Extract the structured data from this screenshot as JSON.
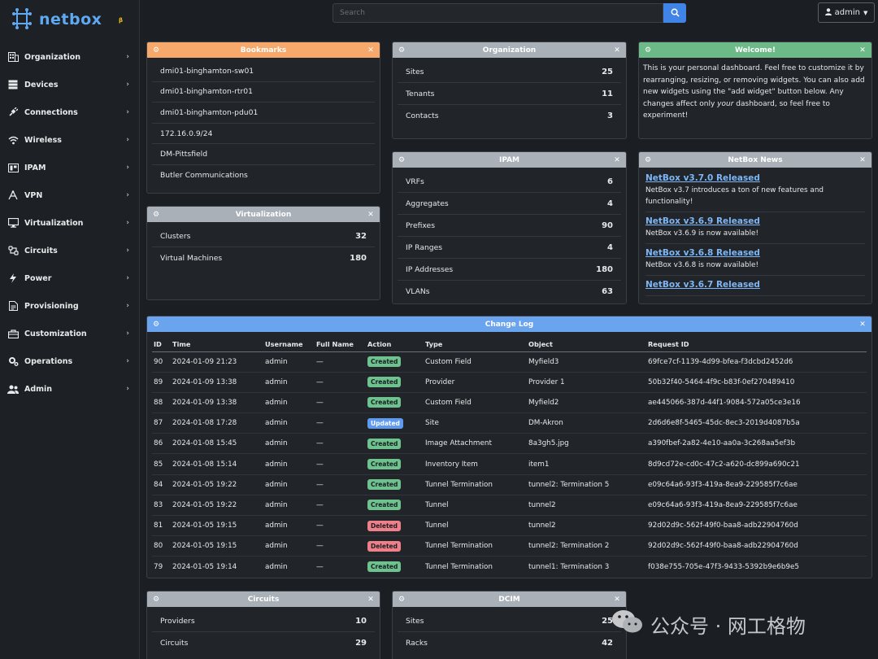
{
  "brand": {
    "name": "netbox",
    "tag": "β"
  },
  "sidebar": {
    "items": [
      {
        "label": "Organization",
        "icon": "building-icon"
      },
      {
        "label": "Devices",
        "icon": "server-icon"
      },
      {
        "label": "Connections",
        "icon": "plug-icon"
      },
      {
        "label": "Wireless",
        "icon": "wifi-icon"
      },
      {
        "label": "IPAM",
        "icon": "ip-icon"
      },
      {
        "label": "VPN",
        "icon": "tunnel-icon"
      },
      {
        "label": "Virtualization",
        "icon": "monitor-icon"
      },
      {
        "label": "Circuits",
        "icon": "circuit-icon"
      },
      {
        "label": "Power",
        "icon": "bolt-icon"
      },
      {
        "label": "Provisioning",
        "icon": "file-icon"
      },
      {
        "label": "Customization",
        "icon": "toolbox-icon"
      },
      {
        "label": "Operations",
        "icon": "cogs-icon"
      },
      {
        "label": "Admin",
        "icon": "users-icon"
      }
    ]
  },
  "search": {
    "placeholder": "Search"
  },
  "user": {
    "label": "admin"
  },
  "bookmarks": {
    "title": "Bookmarks",
    "items": [
      "dmi01-binghamton-sw01",
      "dmi01-binghamton-rtr01",
      "dmi01-binghamton-pdu01",
      "172.16.0.9/24",
      "DM-Pittsfield",
      "Butler Communications"
    ]
  },
  "organization": {
    "title": "Organization",
    "rows": [
      {
        "label": "Sites",
        "value": "25"
      },
      {
        "label": "Tenants",
        "value": "11"
      },
      {
        "label": "Contacts",
        "value": "3"
      }
    ]
  },
  "welcome": {
    "title": "Welcome!",
    "text_a": "This is your personal dashboard. Feel free to customize it by rearranging, resizing, or removing widgets. You can also add new widgets using the \"add widget\" button below. Any changes affect only ",
    "text_em": "your",
    "text_b": " dashboard, so feel free to experiment!"
  },
  "virtualization": {
    "title": "Virtualization",
    "rows": [
      {
        "label": "Clusters",
        "value": "32"
      },
      {
        "label": "Virtual Machines",
        "value": "180"
      }
    ]
  },
  "ipam": {
    "title": "IPAM",
    "rows": [
      {
        "label": "VRFs",
        "value": "6"
      },
      {
        "label": "Aggregates",
        "value": "4"
      },
      {
        "label": "Prefixes",
        "value": "90"
      },
      {
        "label": "IP Ranges",
        "value": "4"
      },
      {
        "label": "IP Addresses",
        "value": "180"
      },
      {
        "label": "VLANs",
        "value": "63"
      }
    ]
  },
  "news": {
    "title": "NetBox News",
    "items": [
      {
        "title": "NetBox v3.7.0 Released",
        "body": "NetBox v3.7 introduces a ton of new features and functionality!"
      },
      {
        "title": "NetBox v3.6.9 Released",
        "body": "NetBox v3.6.9 is now available!"
      },
      {
        "title": "NetBox v3.6.8 Released",
        "body": "NetBox v3.6.8 is now available!"
      },
      {
        "title": "NetBox v3.6.7 Released",
        "body": ""
      }
    ]
  },
  "changelog": {
    "title": "Change Log",
    "columns": [
      "ID",
      "Time",
      "Username",
      "Full Name",
      "Action",
      "Type",
      "Object",
      "Request ID"
    ],
    "rows": [
      {
        "id": "90",
        "time": "2024-01-09 21:23",
        "user": "admin",
        "full": "—",
        "action": "Created",
        "kind": "created",
        "type": "Custom Field",
        "object": "Myfield3",
        "obj_link": true,
        "req": "69fce7cf-1139-4d99-bfea-f3dcbd2452d6"
      },
      {
        "id": "89",
        "time": "2024-01-09 13:38",
        "user": "admin",
        "full": "—",
        "action": "Created",
        "kind": "created",
        "type": "Provider",
        "object": "Provider 1",
        "obj_link": true,
        "req": "50b32f40-5464-4f9c-b83f-0ef270489410"
      },
      {
        "id": "88",
        "time": "2024-01-09 13:38",
        "user": "admin",
        "full": "—",
        "action": "Created",
        "kind": "created",
        "type": "Custom Field",
        "object": "Myfield2",
        "obj_link": true,
        "req": "ae445066-387d-44f1-9084-572a05ce3e16"
      },
      {
        "id": "87",
        "time": "2024-01-08 17:28",
        "user": "admin",
        "full": "—",
        "action": "Updated",
        "kind": "updated",
        "type": "Site",
        "object": "DM-Akron",
        "obj_link": true,
        "req": "2d6d6e8f-5465-45dc-8ec3-2019d4087b5a"
      },
      {
        "id": "86",
        "time": "2024-01-08 15:45",
        "user": "admin",
        "full": "—",
        "action": "Created",
        "kind": "created",
        "type": "Image Attachment",
        "object": "8a3gh5.jpg",
        "obj_link": false,
        "req": "a390fbef-2a82-4e10-aa0a-3c268aa5ef3b"
      },
      {
        "id": "85",
        "time": "2024-01-08 15:14",
        "user": "admin",
        "full": "—",
        "action": "Created",
        "kind": "created",
        "type": "Inventory Item",
        "object": "item1",
        "obj_link": true,
        "req": "8d9cd72e-cd0c-47c2-a620-dc899a690c21"
      },
      {
        "id": "84",
        "time": "2024-01-05 19:22",
        "user": "admin",
        "full": "—",
        "action": "Created",
        "kind": "created",
        "type": "Tunnel Termination",
        "object": "tunnel2: Termination 5",
        "obj_link": true,
        "req": "e09c64a6-93f3-419a-8ea9-229585f7c6ae"
      },
      {
        "id": "83",
        "time": "2024-01-05 19:22",
        "user": "admin",
        "full": "—",
        "action": "Created",
        "kind": "created",
        "type": "Tunnel",
        "object": "tunnel2",
        "obj_link": true,
        "req": "e09c64a6-93f3-419a-8ea9-229585f7c6ae"
      },
      {
        "id": "81",
        "time": "2024-01-05 19:15",
        "user": "admin",
        "full": "—",
        "action": "Deleted",
        "kind": "deleted",
        "type": "Tunnel",
        "object": "tunnel2",
        "obj_link": false,
        "req": "92d02d9c-562f-49f0-baa8-adb22904760d"
      },
      {
        "id": "80",
        "time": "2024-01-05 19:15",
        "user": "admin",
        "full": "—",
        "action": "Deleted",
        "kind": "deleted",
        "type": "Tunnel Termination",
        "object": "tunnel2: Termination 2",
        "obj_link": false,
        "req": "92d02d9c-562f-49f0-baa8-adb22904760d"
      },
      {
        "id": "79",
        "time": "2024-01-05 19:14",
        "user": "admin",
        "full": "—",
        "action": "Created",
        "kind": "created",
        "type": "Tunnel Termination",
        "object": "tunnel1: Termination 3",
        "obj_link": true,
        "req": "f038e755-705e-47f3-9433-5392b9e6b9e5"
      }
    ]
  },
  "circuits": {
    "title": "Circuits",
    "rows": [
      {
        "label": "Providers",
        "value": "10"
      },
      {
        "label": "Circuits",
        "value": "29"
      }
    ]
  },
  "dcim": {
    "title": "DCIM",
    "rows": [
      {
        "label": "Sites",
        "value": "25"
      },
      {
        "label": "Racks",
        "value": "42"
      }
    ]
  },
  "watermark": {
    "text": "公众号 · 网工格物"
  }
}
